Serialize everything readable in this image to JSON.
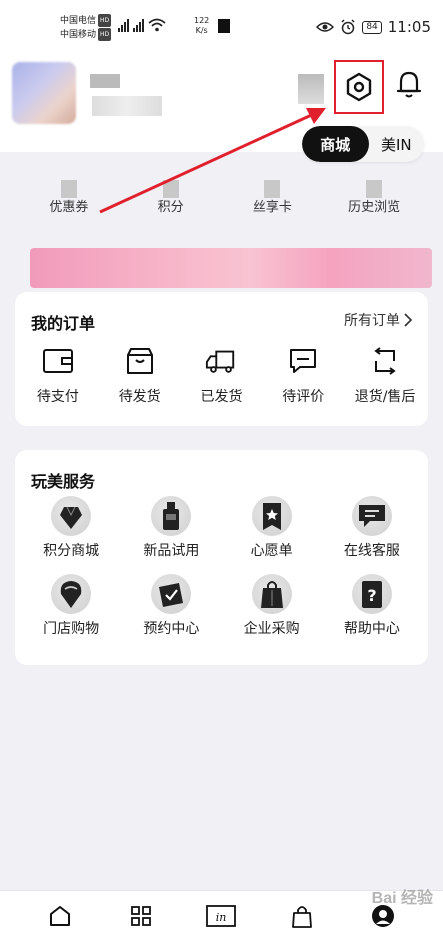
{
  "status_bar": {
    "carrier_1": "中国电信",
    "carrier_1_tag": "HD",
    "carrier_2": "中国移动",
    "carrier_2_tag": "HD",
    "net_label": "4G",
    "net_speed": "122",
    "net_unit": "K/s",
    "battery": "84",
    "time": "11:05"
  },
  "header": {
    "settings_icon": "settings-hexagon-icon",
    "bell_icon": "bell-icon",
    "annotation_color": "#e0202c",
    "toggle": [
      {
        "label": "商城",
        "active": true
      },
      {
        "label": "美IN",
        "active": false
      }
    ]
  },
  "stats": [
    {
      "label": "优惠券"
    },
    {
      "label": "积分"
    },
    {
      "label": "丝享卡"
    },
    {
      "label": "历史浏览"
    }
  ],
  "orders": {
    "title": "我的订单",
    "all_label": "所有订单",
    "items": [
      {
        "label": "待支付",
        "icon": "wallet-icon"
      },
      {
        "label": "待发货",
        "icon": "box-icon"
      },
      {
        "label": "已发货",
        "icon": "truck-icon"
      },
      {
        "label": "待评价",
        "icon": "comment-icon"
      },
      {
        "label": "退货/售后",
        "icon": "return-icon"
      }
    ]
  },
  "services": {
    "title": "玩美服务",
    "items": [
      {
        "label": "积分商城",
        "icon": "points-mall-icon"
      },
      {
        "label": "新品试用",
        "icon": "trial-bottle-icon"
      },
      {
        "label": "心愿单",
        "icon": "wishlist-star-icon"
      },
      {
        "label": "在线客服",
        "icon": "chat-service-icon"
      },
      {
        "label": "门店购物",
        "icon": "store-pin-icon"
      },
      {
        "label": "预约中心",
        "icon": "appointment-icon"
      },
      {
        "label": "企业采购",
        "icon": "shopping-bag-icon"
      },
      {
        "label": "帮助中心",
        "icon": "help-icon"
      }
    ]
  },
  "bottom_nav": [
    {
      "icon": "home-icon"
    },
    {
      "icon": "category-grid-icon"
    },
    {
      "icon": "in-icon"
    },
    {
      "icon": "cart-bag-icon"
    },
    {
      "icon": "profile-icon"
    }
  ],
  "watermark": "Bai 经验"
}
